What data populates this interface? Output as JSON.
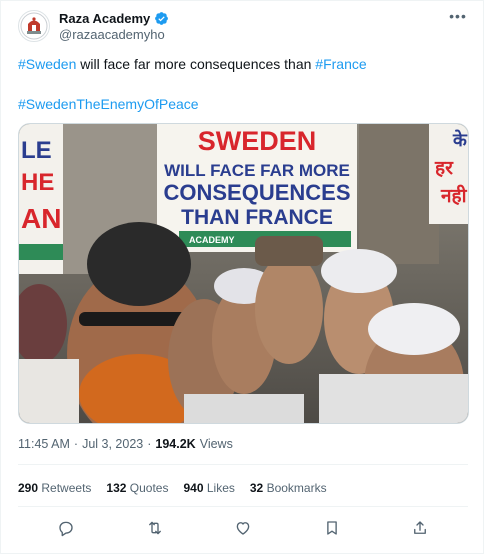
{
  "author": {
    "display_name": "Raza Academy",
    "handle": "@razaacademyho",
    "verified": true,
    "more_label": "•••"
  },
  "tweet": {
    "line1": {
      "hashtag1": "#Sweden",
      "middle": " will face far more consequences than ",
      "hashtag2": "#France"
    },
    "line2": "#SwedenTheEnemyOfPeace"
  },
  "media": {
    "banner_line1": "SWEDEN",
    "banner_line2": "WILL FACE FAR MORE",
    "banner_line3": "CONSEQUENCES",
    "banner_line4": "THAN FRANCE",
    "banner_footer": "ACADEMY",
    "left_sign_lines": [
      "LE",
      "HE",
      "AN"
    ],
    "right_sign_lines": [
      "के",
      "हर",
      "नही"
    ]
  },
  "meta": {
    "time": "11:45 AM",
    "dot1": "·",
    "date": "Jul 3, 2023",
    "dot2": "·",
    "views_count": "194.2K",
    "views_label": "Views"
  },
  "stats": [
    {
      "count": "290",
      "label": "Retweets"
    },
    {
      "count": "132",
      "label": "Quotes"
    },
    {
      "count": "940",
      "label": "Likes"
    },
    {
      "count": "32",
      "label": "Bookmarks"
    }
  ],
  "colors": {
    "link": "#1d9bf0",
    "verified": "#1d9bf0",
    "secondary_text": "#536471",
    "banner_red": "#d8262c",
    "banner_blue": "#2a3d8f"
  },
  "icons": {
    "reply": "reply-icon",
    "retweet": "retweet-icon",
    "like": "heart-icon",
    "bookmark": "bookmark-icon",
    "share": "share-icon",
    "more": "more-icon",
    "verified": "verified-badge-icon"
  }
}
